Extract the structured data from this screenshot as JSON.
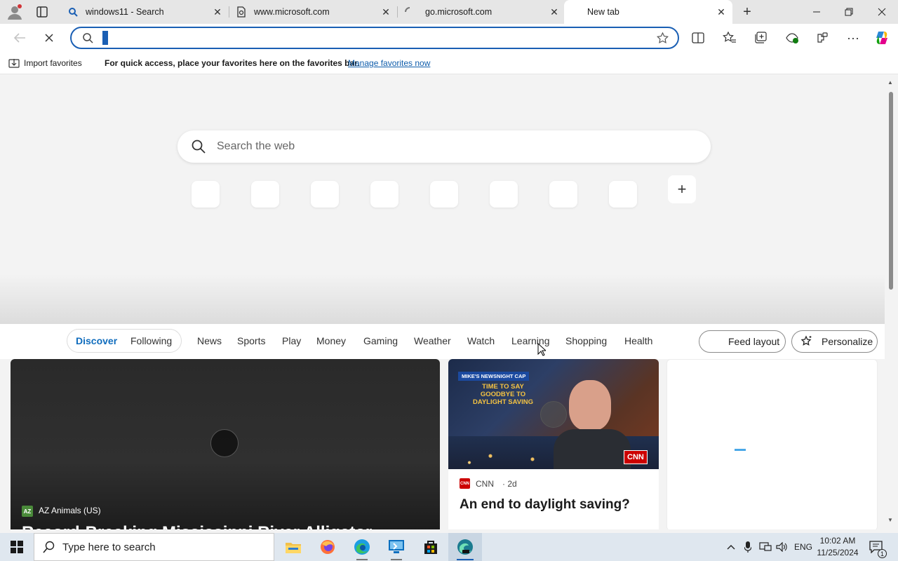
{
  "tabs": [
    {
      "title": "windows11 - Search",
      "icon": "search-icon"
    },
    {
      "title": "www.microsoft.com",
      "icon": "page-icon"
    },
    {
      "title": "go.microsoft.com",
      "icon": "loading-icon"
    },
    {
      "title": "New tab",
      "icon": "none"
    }
  ],
  "toolbar": {
    "address_value": "",
    "accent": "#1a5fb4"
  },
  "favorites_bar": {
    "import_label": "Import favorites",
    "message": "For quick access, place your favorites here on the favorites bar.",
    "manage_link": "Manage favorites now"
  },
  "ntp": {
    "search_placeholder": "Search the web",
    "add_tile_icon": "plus-icon"
  },
  "feed": {
    "tabs": [
      "Discover",
      "Following"
    ],
    "categories": [
      "News",
      "Sports",
      "Play",
      "Money",
      "Gaming",
      "Weather",
      "Watch",
      "Learning",
      "Shopping",
      "Health"
    ],
    "feed_layout_label": "Feed layout",
    "personalize_label": "Personalize",
    "active_color": "#0f6cbd"
  },
  "cards": {
    "big": {
      "source": "AZ Animals (US)",
      "headline": "Record-Breaking Mississippi River Alligator"
    },
    "cnn": {
      "source": "CNN",
      "age": "· 2d",
      "headline": "An end to daylight saving?",
      "image_caption_top": "MIKE'S NEWSNIGHT CAP",
      "image_caption_main": "TIME TO SAY GOODBYE TO DAYLIGHT SAVING",
      "network_logo": "CNN"
    }
  },
  "taskbar": {
    "search_placeholder": "Type here to search",
    "language": "ENG",
    "time": "10:02 AM",
    "date": "11/25/2024",
    "notification_count": "1"
  }
}
